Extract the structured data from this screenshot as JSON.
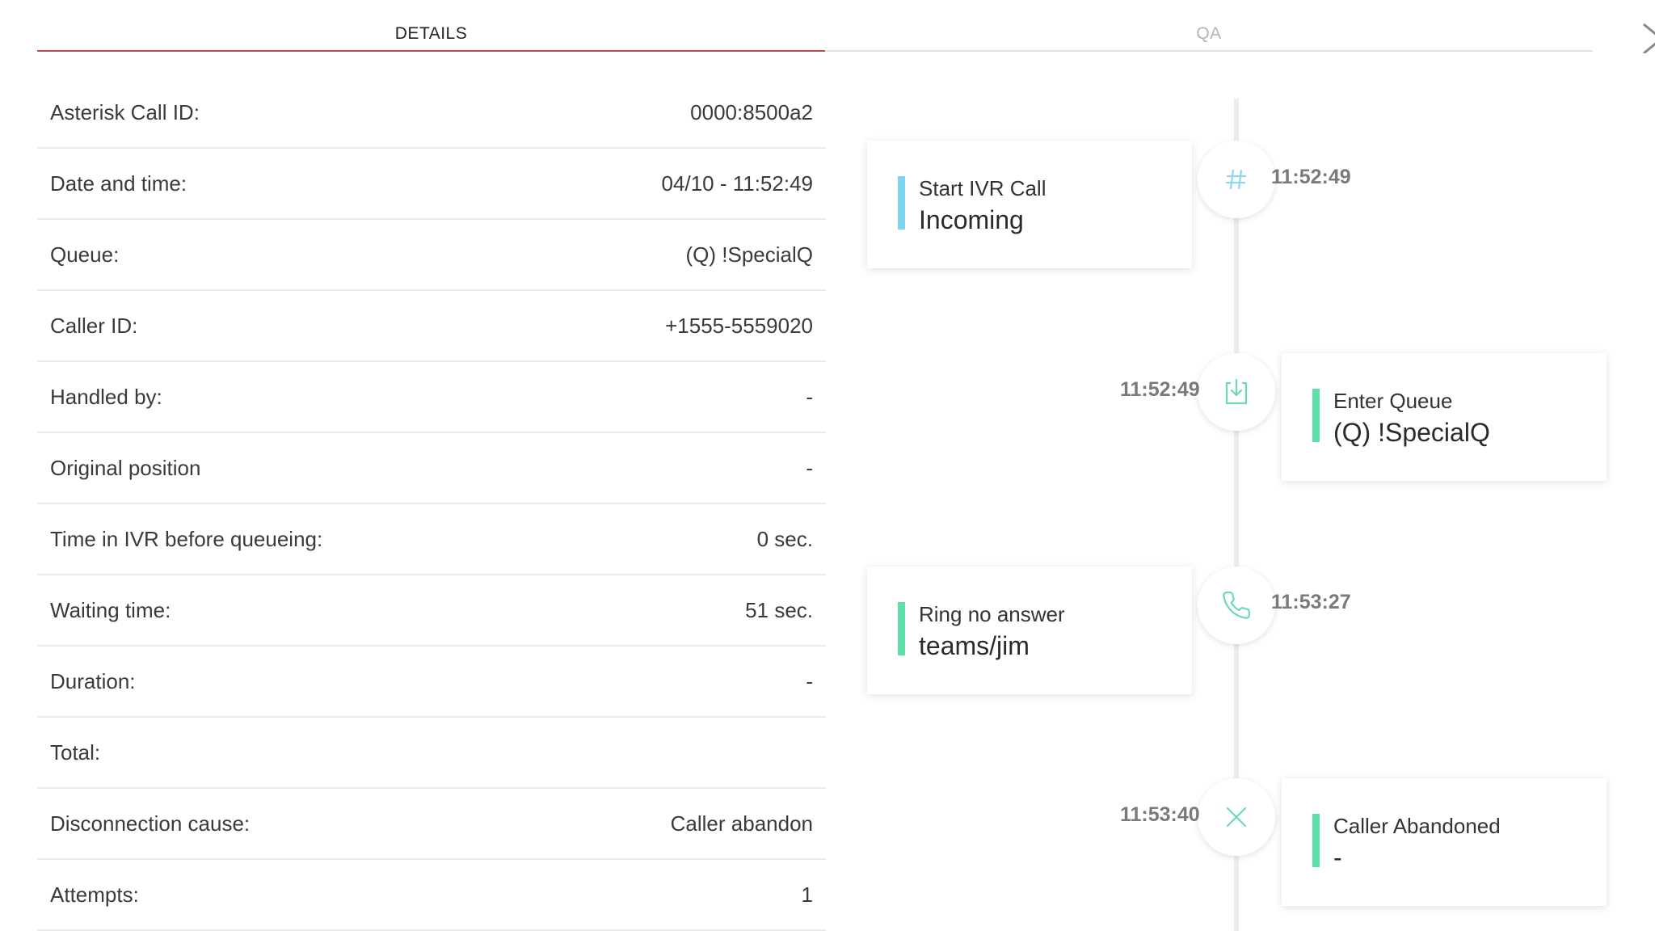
{
  "tabs": {
    "details": "DETAILS",
    "qa": "QA"
  },
  "details": [
    {
      "label": "Asterisk Call ID:",
      "value": "0000:8500a2"
    },
    {
      "label": "Date and time:",
      "value": "04/10 - 11:52:49"
    },
    {
      "label": "Queue:",
      "value": "(Q) !SpecialQ"
    },
    {
      "label": "Caller ID:",
      "value": "+1555-5559020"
    },
    {
      "label": "Handled by:",
      "value": "-"
    },
    {
      "label": "Original position",
      "value": "-"
    },
    {
      "label": "Time in IVR before queueing:",
      "value": "0 sec."
    },
    {
      "label": "Waiting time:",
      "value": "51 sec."
    },
    {
      "label": "Duration:",
      "value": "-"
    },
    {
      "label": "Total:",
      "value": ""
    },
    {
      "label": "Disconnection cause:",
      "value": "Caller abandon"
    },
    {
      "label": "Attempts:",
      "value": "1"
    }
  ],
  "timeline": [
    {
      "icon": "hash-icon",
      "time": "11:52:49",
      "title": "Start IVR Call",
      "subtitle": "Incoming",
      "accent": "#7dd3f0",
      "side": "left"
    },
    {
      "icon": "queue-enter-icon",
      "time": "11:52:49",
      "title": "Enter Queue",
      "subtitle": "(Q) !SpecialQ",
      "accent": "#5de0a8",
      "side": "right"
    },
    {
      "icon": "phone-icon",
      "time": "11:53:27",
      "title": "Ring no answer",
      "subtitle": "teams/jim",
      "accent": "#5de0a8",
      "side": "left"
    },
    {
      "icon": "x-icon",
      "time": "11:53:40",
      "title": "Caller Abandoned",
      "subtitle": "-",
      "accent": "#5de0a8",
      "side": "right"
    }
  ],
  "colors": {
    "active_tab_underline": "#b84a4a",
    "ivr_accent": "#7dd3f0",
    "event_accent": "#5de0a8",
    "icon_color": "#6fd9b5"
  }
}
